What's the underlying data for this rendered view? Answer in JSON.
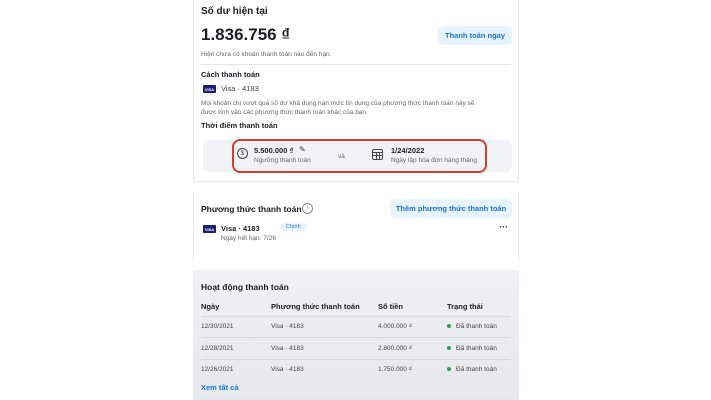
{
  "balance": {
    "title": "Số dư hiện tại",
    "amount": "1.836.756 ₫",
    "pay_now": "Thanh toán ngay",
    "note": "Hiện chưa có khoản thanh toán nào đến hạn."
  },
  "payment_method_section": {
    "title": "Cách thanh toán",
    "card": "Visa · 4183",
    "note_line1": "Mọi khoản chi vượt quá số dư khả dụng hạn mức tín dụng của phương thức thanh toán này sẽ",
    "note_line2": "được tính vào các phương thức thanh toán khác của bạn."
  },
  "billing_time": {
    "title": "Thời điểm thanh toán",
    "threshold_value": "5.500.000 ₫",
    "threshold_label": "Ngưỡng thanh toán",
    "and": "và",
    "date_value": "1/24/2022",
    "date_label": "Ngày lập hóa đơn hàng tháng"
  },
  "methods": {
    "title": "Phương thức thanh toán",
    "add_button": "Thêm phương thức thanh toán",
    "card": "Visa · 4183",
    "badge": "Chính",
    "expiry": "Ngày hết hạn: 7/26",
    "more": "···"
  },
  "activity": {
    "title": "Hoạt động thanh toán",
    "headers": [
      "Ngày",
      "Phương thức thanh toán",
      "Số tiền",
      "Trạng thái"
    ],
    "rows": [
      [
        "12/30/2021",
        "Visa · 4183",
        "4.000.000 ₫",
        "Đã thanh toán"
      ],
      [
        "12/28/2021",
        "Visa · 4183",
        "2.800.000 ₫",
        "Đã thanh toán"
      ],
      [
        "12/26/2021",
        "Visa · 4183",
        "1.750.000 ₫",
        "Đã thanh toán"
      ]
    ],
    "see_all": "Xem tất cả"
  },
  "colors": {
    "accent": "#1b74e4",
    "highlight": "#d0412a",
    "paid": "#31a24c"
  }
}
